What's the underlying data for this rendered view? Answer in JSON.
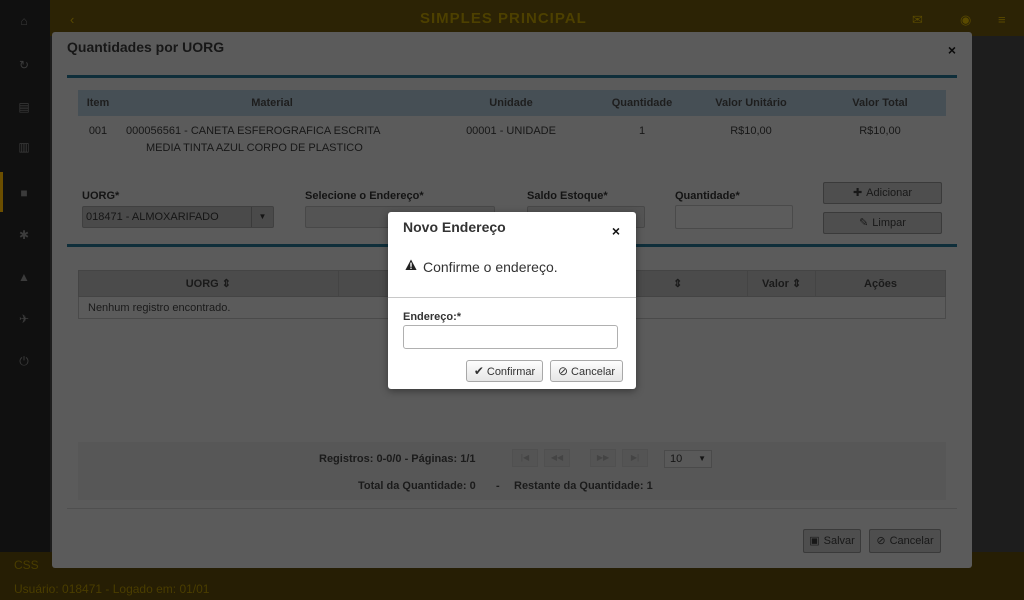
{
  "background": {
    "header_title": "SIMPLES PRINCIPAL",
    "footer_line1": "CSS",
    "footer_line2": "Usuário: 018471 - Logado em: 01/01"
  },
  "main_dialog": {
    "title": "Quantidades por UORG",
    "close_icon": "×",
    "items_table": {
      "headers": [
        "Item",
        "Material",
        "Unidade",
        "Quantidade",
        "Valor Unitário",
        "Valor Total"
      ],
      "rows": [
        {
          "item": "001",
          "material_line1": "000056561 - CANETA ESFEROGRAFICA ESCRITA",
          "material_line2": "MEDIA TINTA AZUL CORPO DE PLASTICO",
          "unidade": "00001 - UNIDADE",
          "quantidade": "1",
          "valor_unitario": "R$10,00",
          "valor_total": "R$10,00"
        }
      ]
    },
    "form": {
      "uorg_label": "UORG*",
      "uorg_value": "018471 - ALMOXARIFADO",
      "endereco_label": "Selecione o Endereço*",
      "saldo_label": "Saldo Estoque*",
      "quantidade_label": "Quantidade*",
      "adicionar_label": "Adicionar",
      "limpar_label": "Limpar"
    },
    "results_table": {
      "headers": [
        "UORG",
        "",
        "",
        "Valor",
        "Ações"
      ],
      "empty_message": "Nenhum registro encontrado."
    },
    "pager": {
      "registros": "Registros: 0-0/0 - Páginas: 1/1",
      "page_size": "10",
      "total_quantidade": "Total da Quantidade: 0",
      "separator": "-",
      "restante_quantidade": "Restante da Quantidade: 1"
    },
    "salvar_label": "Salvar",
    "cancelar_label": "Cancelar"
  },
  "confirm_dialog": {
    "title": "Novo Endereço",
    "close_icon": "×",
    "message": "Confirme o endereço.",
    "field_label": "Endereço:*",
    "field_value": "",
    "confirm_label": "Confirmar",
    "cancel_label": "Cancelar"
  }
}
